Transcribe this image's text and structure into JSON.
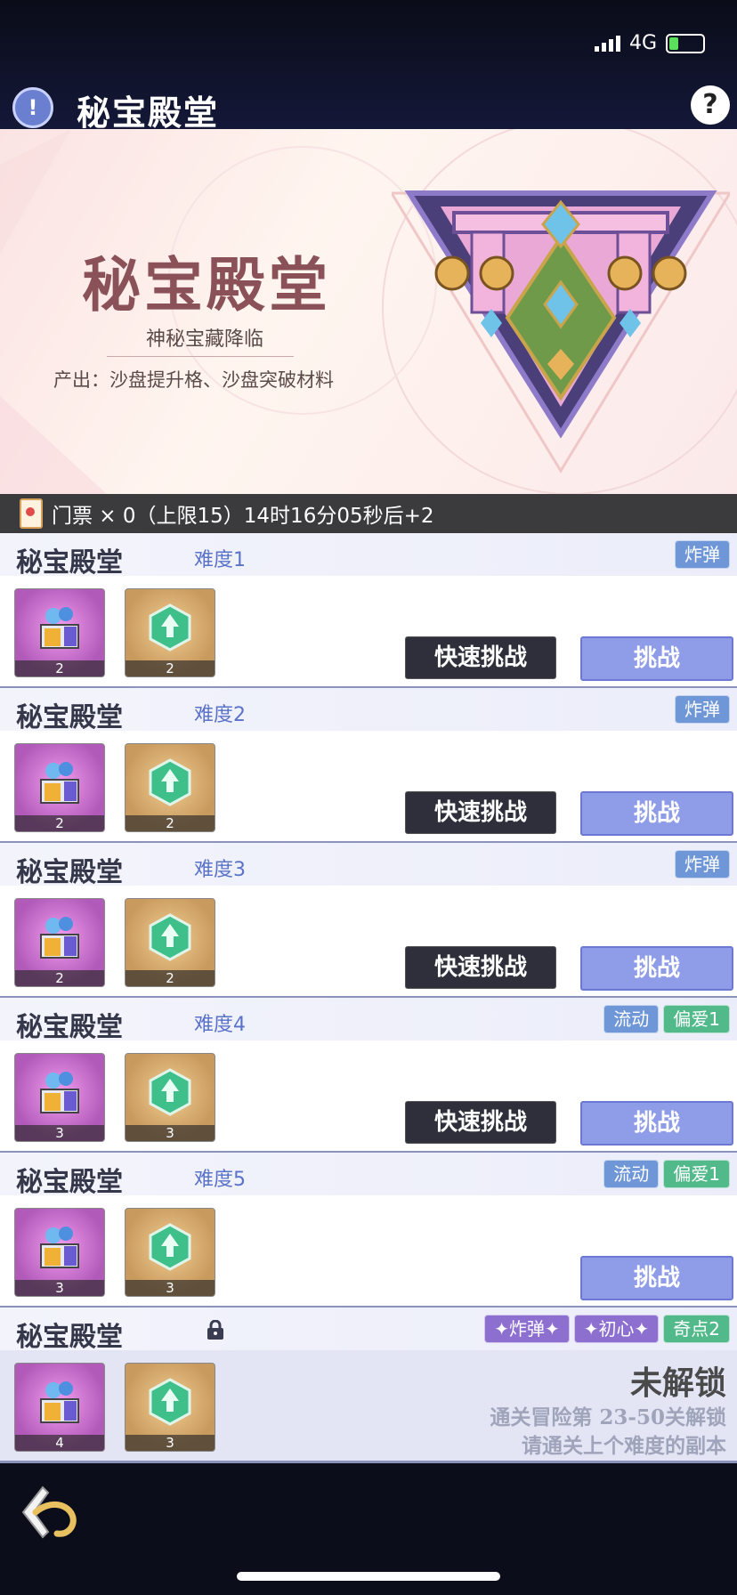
{
  "status": {
    "network": "4G"
  },
  "header": {
    "title": "秘宝殿堂",
    "info_icon": "exclamation-icon",
    "help_icon": "question-icon"
  },
  "banner": {
    "title": "秘宝殿堂",
    "subtitle": "神秘宝藏降临",
    "output": "产出：沙盘提升格、沙盘突破材料"
  },
  "ticket": {
    "text": "门票 × 0（上限15）14时16分05秒后+2"
  },
  "rows": [
    {
      "name": "秘宝殿堂",
      "difficulty": "难度1",
      "tags": [
        "炸弹"
      ],
      "items": [
        "2",
        "2"
      ],
      "quick": "快速挑战",
      "challenge": "挑战"
    },
    {
      "name": "秘宝殿堂",
      "difficulty": "难度2",
      "tags": [
        "炸弹"
      ],
      "items": [
        "2",
        "2"
      ],
      "quick": "快速挑战",
      "challenge": "挑战"
    },
    {
      "name": "秘宝殿堂",
      "difficulty": "难度3",
      "tags": [
        "炸弹"
      ],
      "items": [
        "2",
        "2"
      ],
      "quick": "快速挑战",
      "challenge": "挑战"
    },
    {
      "name": "秘宝殿堂",
      "difficulty": "难度4",
      "tags": [
        "流动",
        "偏爱1"
      ],
      "items": [
        "3",
        "3"
      ],
      "quick": "快速挑战",
      "challenge": "挑战"
    },
    {
      "name": "秘宝殿堂",
      "difficulty": "难度5",
      "tags": [
        "流动",
        "偏爱1"
      ],
      "items": [
        "3",
        "3"
      ],
      "challenge": "挑战"
    },
    {
      "name": "秘宝殿堂",
      "tags": [
        "✦炸弹✦",
        "✦初心✦",
        "奇点2"
      ],
      "items": [
        "4",
        "3"
      ],
      "locked_title": "未解锁",
      "locked_line1": "通关冒险第 23-50关解锁",
      "locked_line2": "请通关上个难度的副本"
    }
  ],
  "colors": {
    "accent": "#8f9de9",
    "dark_button": "#2e2f3a",
    "tag_blue": "#6f97d8",
    "tag_green": "#52b98b"
  }
}
